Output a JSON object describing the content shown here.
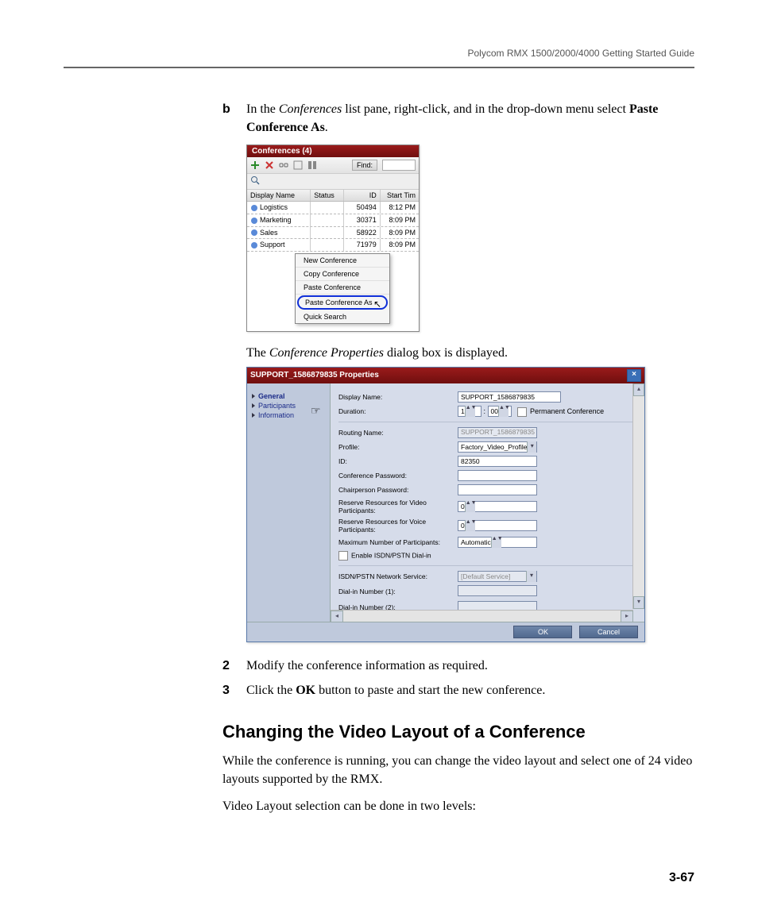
{
  "header": {
    "running": "Polycom RMX 1500/2000/4000 Getting Started Guide"
  },
  "steps": {
    "b_label": "b",
    "b_text_1": "In the ",
    "b_text_em1": "Conferences",
    "b_text_2": " list pane, right-click, and in the drop-down menu select ",
    "b_text_strong": "Paste Conference As",
    "b_text_3": ".",
    "caption_1a": "The ",
    "caption_1em": "Conference Properties",
    "caption_1b": " dialog box is displayed.",
    "s2_label": "2",
    "s2_text": "Modify the conference information as required.",
    "s3_label": "3",
    "s3_text_1": "Click the ",
    "s3_strong": "OK",
    "s3_text_2": " button to paste and start the new conference."
  },
  "shot1": {
    "title": "Conferences (4)",
    "find_label": "Find:",
    "columns": {
      "name": "Display Name",
      "status": "Status",
      "id": "ID",
      "time": "Start Tim"
    },
    "rows": [
      {
        "name": "Logistics",
        "id": "50494",
        "time": "8:12 PM"
      },
      {
        "name": "Marketing",
        "id": "30371",
        "time": "8:09 PM"
      },
      {
        "name": "Sales",
        "id": "58922",
        "time": "8:09 PM"
      },
      {
        "name": "Support",
        "id": "71979",
        "time": "8:09 PM"
      }
    ],
    "menu": {
      "new_conf": "New Conference",
      "copy_conf": "Copy Conference",
      "paste_conf": "Paste Conference",
      "paste_conf_as": "Paste Conference As",
      "quick_search": "Quick Search"
    }
  },
  "shot2": {
    "title": "SUPPORT_1586879835 Properties",
    "nav": {
      "general": "General",
      "participants": "Participants",
      "information": "Information"
    },
    "labels": {
      "display_name": "Display Name:",
      "duration": "Duration:",
      "permanent": "Permanent Conference",
      "routing": "Routing Name:",
      "profile": "Profile:",
      "id": "ID:",
      "conf_pw": "Conference Password:",
      "chair_pw": "Chairperson Password:",
      "res_video": "Reserve Resources for Video Participants:",
      "res_voice": "Reserve Resources for Voice Participants:",
      "max_part": "Maximum Number of Participants:",
      "enable_isdn": "Enable ISDN/PSTN Dial-in",
      "isdn_svc": "ISDN/PSTN Network Service:",
      "dial1": "Dial-in Number (1):",
      "dial2": "Dial-in Number (2):"
    },
    "values": {
      "display_name": "SUPPORT_1586879835",
      "duration_h": "1",
      "duration_m": "00",
      "routing": "SUPPORT_1586879835",
      "profile": "Factory_Video_Profile",
      "id": "82350",
      "res_video": "0",
      "res_voice": "0",
      "max_part": "Automatic",
      "isdn_svc": "[Default Service]"
    },
    "buttons": {
      "ok": "OK",
      "cancel": "Cancel"
    }
  },
  "section": {
    "heading": "Changing the Video Layout of a Conference",
    "p1": "While the conference is running, you can change the video layout and select one of 24 video layouts supported by the RMX.",
    "p2": "Video Layout selection can be done in two levels:"
  },
  "footer": {
    "page": "3-67"
  }
}
